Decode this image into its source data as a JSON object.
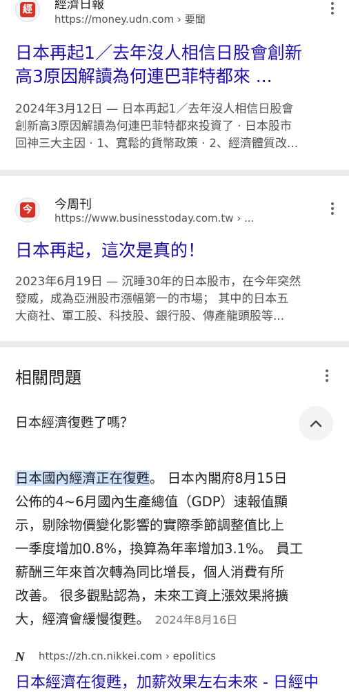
{
  "results": [
    {
      "site_name": "經濟日報",
      "url": "https://money.udn.com",
      "crumb": "› 要聞",
      "logo_glyph": "經",
      "title": "日本再起1／去年沒人相信日股創新高3原因解讀為何連巴菲特都來 ...",
      "title_line1": "日本再起1／去年沒人相信日股會創新",
      "title_line2": "高3原因解讀為何連巴菲特都來 ...",
      "snippet_line1": "2024年3月12日 — 日本再起1／去年沒人相信日股會",
      "snippet_line2": "創新高3原因解讀為何連巴菲特都來投資了 · 日本股市",
      "snippet_line3": "回神三大主因 · 1、寬鬆的貨幣政策 · 2、經濟體質改..."
    },
    {
      "site_name": "今周刊",
      "url": "https://www.businesstoday.com.tw",
      "crumb": "› ...",
      "logo_glyph": "今",
      "title": "日本再起，這次是真的！",
      "snippet_line1": "2023年6月19日 — 沉睡30年的日本股市，在今年突然",
      "snippet_line2": "發威，成為亞洲股市漲幅第一的市場； 其中的日本五",
      "snippet_line3": "大商社、軍工股、科技股、銀行股、傳產龍頭股等..."
    }
  ],
  "paa": {
    "heading": "相關問題",
    "question": "日本經濟復甦了嗎？",
    "answer_highlight": "日本國內經濟正在復甦",
    "answer_line1_rest": "。 日本內閣府8月15日",
    "answer_line2": "公佈的4~6月國內生產總值（GDP）速報值顯",
    "answer_line3": "示，剔除物價變化影響的實際季節調整值比上",
    "answer_line4": "一季度增加0.8%，換算為年率增加3.1%。 員工",
    "answer_line5": "薪酬三年來首次轉為同比增長，個人消費有所",
    "answer_line6": "改善。 很多觀點認為，未來工資上漲效果將擴",
    "answer_line7": "大，經濟會緩慢復甦。",
    "answer_date": "2024年8月16日",
    "source_logo": "N",
    "source_url": "https://zh.cn.nikkei.com › epolitics",
    "source_title": "日本經濟在復甦，加薪效果左右未來 - 日經中"
  },
  "colors": {
    "link": "#1a0dab",
    "highlight": "#d2e3fc",
    "divider": "#e8eaed"
  },
  "icons": [
    "kebab-menu-icon",
    "chevron-up-icon"
  ]
}
